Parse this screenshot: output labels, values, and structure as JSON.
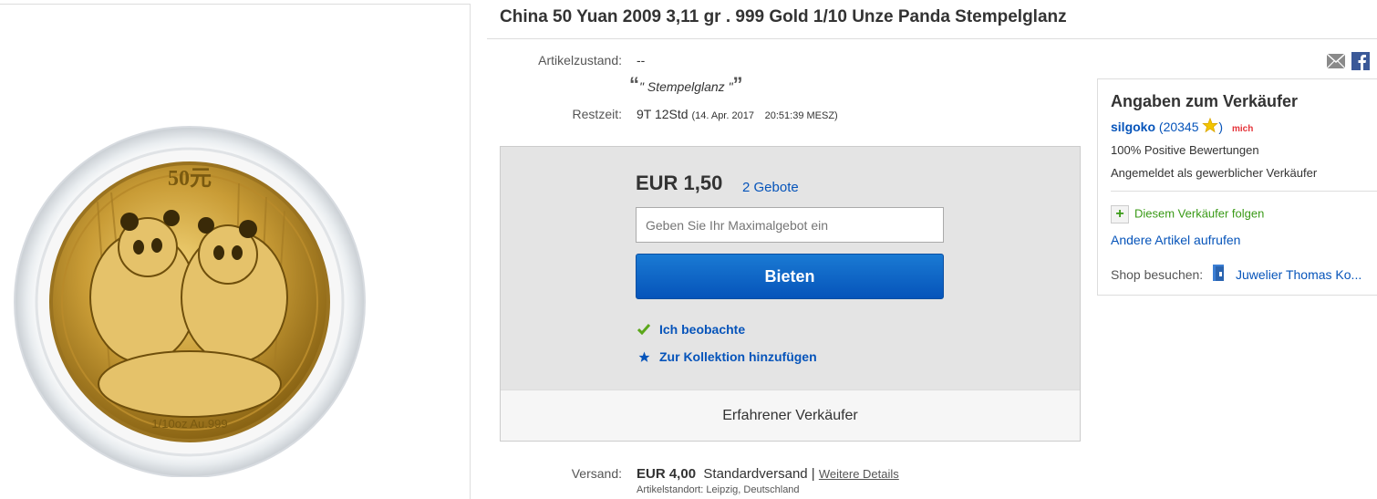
{
  "listing": {
    "title": "China 50 Yuan 2009 3,11 gr . 999 Gold 1/10 Unze Panda Stempelglanz"
  },
  "condition": {
    "label": "Artikelzustand:",
    "value": "--",
    "quote_open": "“",
    "quote_text": "\" Stempelglanz \"",
    "quote_close": "”"
  },
  "time_left": {
    "label": "Restzeit:",
    "value": "9T 12Std",
    "end_date": "(14. Apr. 2017",
    "end_time": "20:51:39 MESZ)"
  },
  "bid": {
    "price": "EUR 1,50",
    "bids_count": "2 Gebote",
    "max_bid_placeholder": "Geben Sie Ihr Maximalgebot ein",
    "bid_button": "Bieten",
    "watch_label": "Ich beobachte",
    "collection_label": "Zur Kollektion hinzufügen",
    "seller_badge": "Erfahrener Verkäufer"
  },
  "shipping": {
    "label": "Versand:",
    "price": "EUR 4,00",
    "method": "Standardversand |",
    "details_link": "Weitere Details",
    "location": "Artikelstandort:  Leipzig, Deutschland"
  },
  "seller": {
    "heading": "Angaben zum Verkäufer",
    "name": "silgoko",
    "rating_open": "(",
    "rating": "20345",
    "rating_close": ")",
    "me_badge": "mich",
    "positive": "100% Positive Bewertungen",
    "type": "Angemeldet als gewerblicher Verkäufer",
    "follow": "Diesem Verkäufer folgen",
    "other_items": "Andere Artikel aufrufen",
    "shop_label": "Shop besuchen:",
    "shop_name": "Juwelier Thomas Ko..."
  },
  "colors": {
    "link": "#0654ba",
    "button": "#0654ba",
    "follow_green": "#3a9a17",
    "watch_check": "#5ba71b",
    "star": "#f2c500"
  },
  "icons": [
    "mail-icon",
    "facebook-icon",
    "check-icon",
    "star-icon",
    "plus-icon",
    "store-icon",
    "rating-star-icon"
  ]
}
